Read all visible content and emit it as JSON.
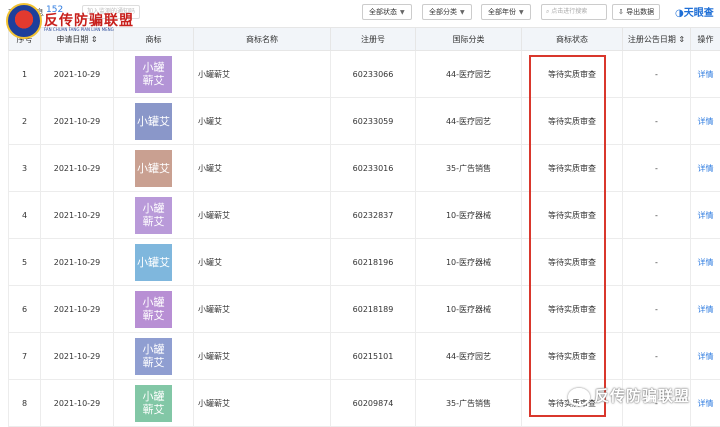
{
  "header": {
    "logo_text": "反传防骗联盟",
    "logo_sub": "FAN CHUAN FANG PIAN LIAN MENG",
    "count_label": "商标信息",
    "count": "152",
    "notify_label": "加入监测的通知吗",
    "filters": [
      {
        "label": "全部状态"
      },
      {
        "label": "全部分类"
      },
      {
        "label": "全部年份"
      }
    ],
    "search_placeholder": "点击进行搜索",
    "export_label": "导出数据",
    "brand": "天眼查"
  },
  "table": {
    "columns": [
      "序号",
      "申请日期",
      "商标",
      "商标名称",
      "注册号",
      "国际分类",
      "商标状态",
      "注册公告日期",
      "操作"
    ],
    "rows": [
      {
        "no": "1",
        "date": "2021-10-29",
        "mark": "小罐蕲艾",
        "mark_color": "#b394d6",
        "name": "小罐蕲艾",
        "reg": "60233066",
        "cls": "44-医疗园艺",
        "status": "等待实质审查",
        "pub": "-",
        "op": "详情"
      },
      {
        "no": "2",
        "date": "2021-10-29",
        "mark": "小罐艾",
        "mark_color": "#8a97c9",
        "name": "小罐艾",
        "reg": "60233059",
        "cls": "44-医疗园艺",
        "status": "等待实质审查",
        "pub": "-",
        "op": "详情"
      },
      {
        "no": "3",
        "date": "2021-10-29",
        "mark": "小罐艾",
        "mark_color": "#c9a091",
        "name": "小罐艾",
        "reg": "60233016",
        "cls": "35-广告销售",
        "status": "等待实质审查",
        "pub": "-",
        "op": "详情"
      },
      {
        "no": "4",
        "date": "2021-10-29",
        "mark": "小罐蕲艾",
        "mark_color": "#b99ad9",
        "name": "小罐蕲艾",
        "reg": "60232837",
        "cls": "10-医疗器械",
        "status": "等待实质审查",
        "pub": "-",
        "op": "详情"
      },
      {
        "no": "5",
        "date": "2021-10-29",
        "mark": "小罐艾",
        "mark_color": "#7fb7dd",
        "name": "小罐艾",
        "reg": "60218196",
        "cls": "10-医疗器械",
        "status": "等待实质审查",
        "pub": "-",
        "op": "详情"
      },
      {
        "no": "6",
        "date": "2021-10-29",
        "mark": "小罐蕲艾",
        "mark_color": "#b88fd4",
        "name": "小罐蕲艾",
        "reg": "60218189",
        "cls": "10-医疗器械",
        "status": "等待实质审查",
        "pub": "-",
        "op": "详情"
      },
      {
        "no": "7",
        "date": "2021-10-29",
        "mark": "小罐蕲艾",
        "mark_color": "#8f9ed1",
        "name": "小罐蕲艾",
        "reg": "60215101",
        "cls": "44-医疗园艺",
        "status": "等待实质审查",
        "pub": "-",
        "op": "详情"
      },
      {
        "no": "8",
        "date": "2021-10-29",
        "mark": "小罐蕲艾",
        "mark_color": "#82c7a6",
        "name": "小罐蕲艾",
        "reg": "60209874",
        "cls": "35-广告销售",
        "status": "等待实质审查",
        "pub": "-",
        "op": "详情"
      }
    ]
  },
  "watermark": "反传防骗联盟"
}
